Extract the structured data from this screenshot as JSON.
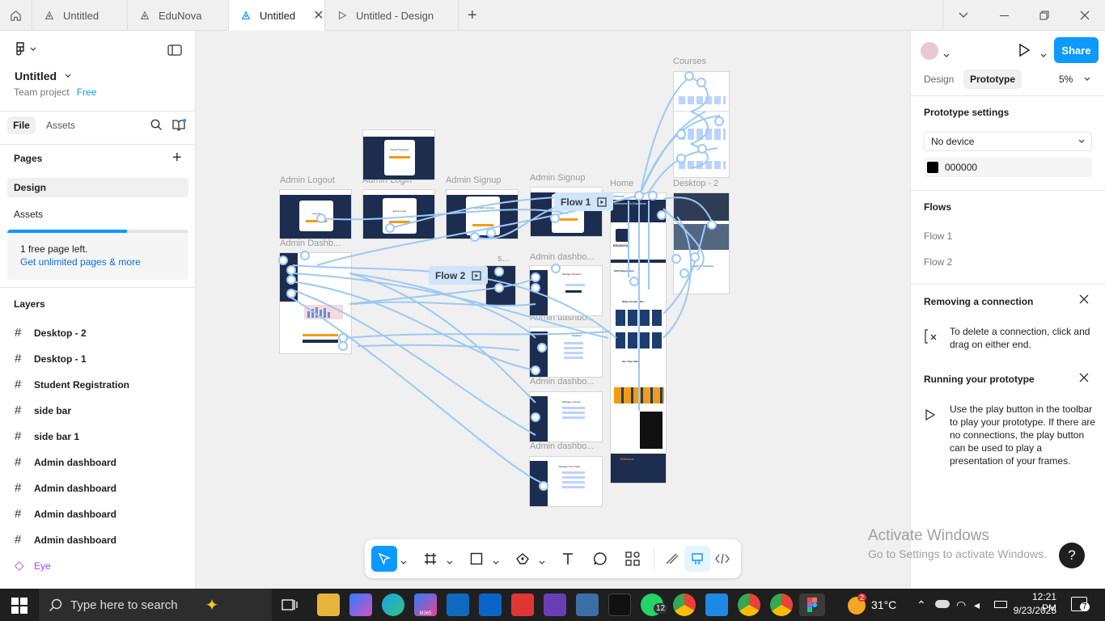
{
  "tabs": [
    {
      "label": "Untitled"
    },
    {
      "label": "EduNova"
    },
    {
      "label": "Untitled"
    },
    {
      "label": "Untitled - Design"
    }
  ],
  "left": {
    "file_name": "Untitled",
    "team": "Team project",
    "plan_badge": "Free",
    "tab_file": "File",
    "tab_assets": "Assets",
    "pages_title": "Pages",
    "pages": [
      "Design",
      "Assets"
    ],
    "pages_left": "1 free page left.",
    "pages_left_fraction": 0.66,
    "upgrade_link": "Get unlimited pages & more",
    "layers_title": "Layers",
    "layers": [
      "Desktop - 2",
      "Desktop - 1",
      "Student Registration",
      "side bar",
      "side bar 1",
      "Admin dashboard",
      "Admin dashboard",
      "Admin dashboard",
      "Admin dashboard",
      "Eye"
    ]
  },
  "canvas": {
    "labels": {
      "courses": "Courses",
      "home": "Home",
      "desktop2": "Desktop - 2",
      "admin_logout": "Admin Logout",
      "admin_login": "Admin Login",
      "admin_signup1": "Admin Signup",
      "admin_signup2": "Admin Signup",
      "admin_dashb": "Admin Dashb...",
      "admin_dashbo1": "Admin dashbo...",
      "admin_dashbo2": "Admin dashbo...",
      "admin_dashbo3": "Admin dashbo...",
      "admin_dashbo4": "Admin dashbo...",
      "s": "s..."
    },
    "flow1": "Flow 1",
    "flow2": "Flow 2",
    "thumb_texts": {
      "forgot": "Forgot Password",
      "logout": "Log Out",
      "login": "Admin Login",
      "create": "Create Admin account",
      "welcome": "Welcome To EduNova",
      "edunova": "EDUNOVA",
      "registration": "2025 Registration",
      "what": "What Can We Offer",
      "timetable": "Our Time Table",
      "footer": "EduNova",
      "register": "Register for EduNova",
      "students": "Manage Students",
      "teachers": "Teachers",
      "courses": "Manage Courses",
      "timetab": "Manage Time Table"
    }
  },
  "right": {
    "design_tab": "Design",
    "prototype_tab": "Prototype",
    "zoom": "5%",
    "share": "Share",
    "proto_settings": "Prototype settings",
    "device": "No device",
    "bg_color": "000000",
    "flows_title": "Flows",
    "flows": [
      "Flow 1",
      "Flow 2"
    ],
    "removing_title": "Removing a connection",
    "removing_text": "To delete a connection, click and drag on either end.",
    "running_title": "Running your prototype",
    "running_text": "Use the play button in the toolbar to play your prototype. If there are no connections, the play button can be used to play a presentation of your frames."
  },
  "watermark": {
    "title": "Activate Windows",
    "subtitle": "Go to Settings to activate Windows."
  },
  "taskbar": {
    "search_placeholder": "Type here to search",
    "weather": "31°C",
    "weather_badge": "2",
    "time": "12:21 PM",
    "date": "9/23/2025",
    "whatsapp_badge": "12",
    "notif_badge": "7",
    "m365": "M365"
  },
  "colors": {
    "accent": "#0d99ff",
    "navy": "#1d2d50",
    "connector": "#9cc9f5"
  }
}
